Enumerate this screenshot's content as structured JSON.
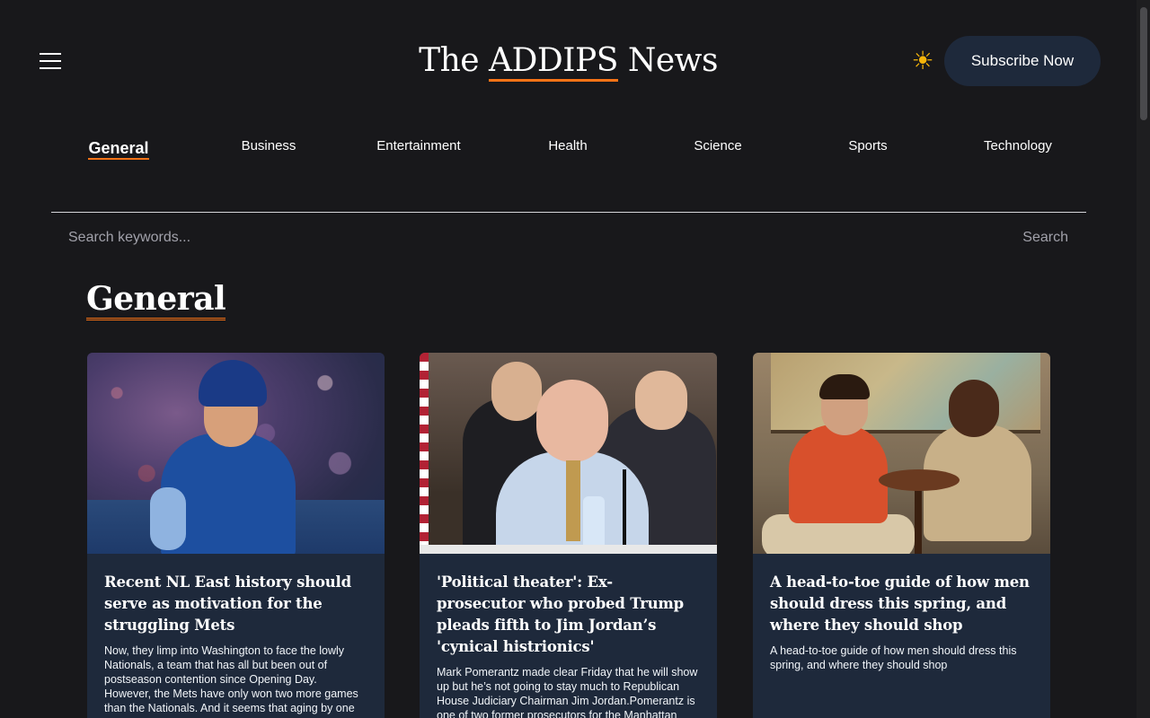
{
  "header": {
    "menu_icon": "hamburger-menu-icon",
    "title_prefix": "The ",
    "title_brand": "ADDIPS",
    "title_suffix": " News",
    "theme_icon": "sun-icon",
    "theme_glyph": "☀",
    "subscribe_label": "Subscribe Now"
  },
  "nav": {
    "items": [
      {
        "label": "General",
        "active": true
      },
      {
        "label": "Business",
        "active": false
      },
      {
        "label": "Entertainment",
        "active": false
      },
      {
        "label": "Health",
        "active": false
      },
      {
        "label": "Science",
        "active": false
      },
      {
        "label": "Sports",
        "active": false
      },
      {
        "label": "Technology",
        "active": false
      }
    ]
  },
  "search": {
    "placeholder": "Search keywords...",
    "value": "",
    "button_label": "Search"
  },
  "section": {
    "title": "General"
  },
  "articles": [
    {
      "title": "Recent NL East history should serve as motivation for the struggling Mets",
      "description": "Now, they limp into Washington to face the lowly Nationals, a team that has all but been out of postseason contention since Opening Day. However, the Mets have only won two more games than the Nationals. And it seems that aging by one",
      "image": "baseball-player-photo"
    },
    {
      "title": "'Political theater': Ex-prosecutor who probed Trump pleads fifth to Jim Jordan’s 'cynical histrionics'",
      "description": "Mark Pomerantz made clear Friday that he will show up but he’s not going to stay much to Republican House Judiciary Chairman Jim Jordan.Pomerantz is one of two former prosecutors for the Manhattan District Attorney’s",
      "image": "congressional-hearing-photo"
    },
    {
      "title": "A head-to-toe guide of how men should dress this spring, and where they should shop",
      "description": "A head-to-toe guide of how men should dress this spring, and where they should shop",
      "image": "mens-fashion-photo"
    }
  ],
  "colors": {
    "background": "#18181b",
    "accent": "#f97316",
    "card_bg": "#1e293b",
    "sun": "#f5b50a"
  }
}
